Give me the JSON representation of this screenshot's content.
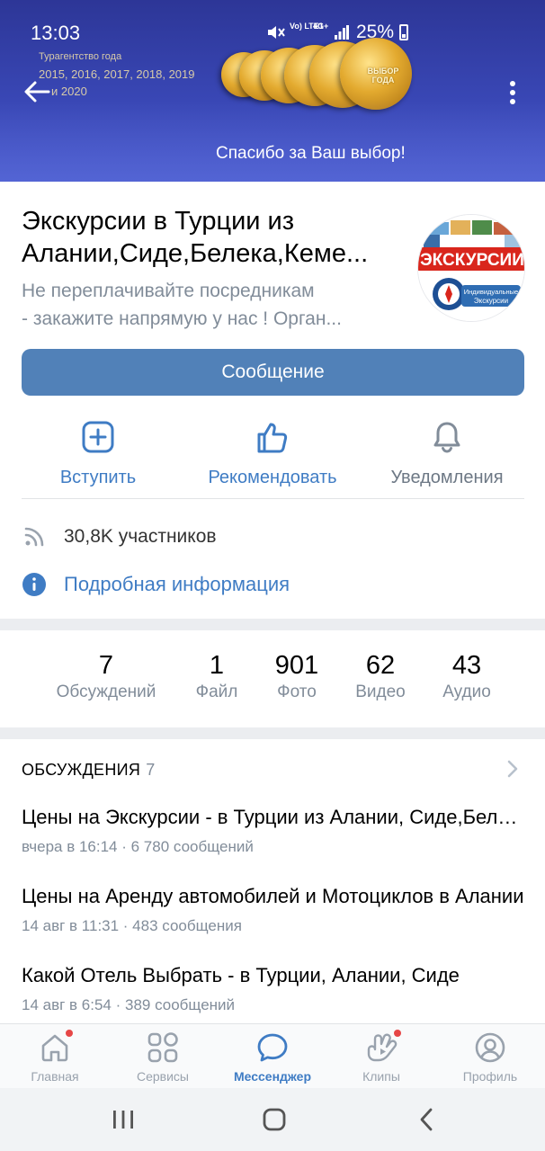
{
  "status_bar": {
    "time": "13:03",
    "network_1": "Vo) LTE1",
    "network_2": "4G+",
    "battery": "25%"
  },
  "cover": {
    "award_text_line1": "Турагентство года",
    "award_text_line2": "2015, 2016, 2017, 2018, 2019",
    "award_text_line3": "и 2020",
    "coin_label": "ВЫБОР ГОДА",
    "caption": "Спасибо за Ваш выбор!",
    "back_icon": "arrow-left-icon",
    "menu_icon": "more-vertical-icon"
  },
  "group": {
    "title_line1": "Экскурсии в Турции из",
    "title_line2": "Алании,Сиде,Белека,Кеме...",
    "status_line1": "Не переплачивайте посредникам",
    "status_line2": "- закажите напрямую у нас ! Орган...",
    "avatar_text": "ЭКСКУРСИИ",
    "avatar_subtext_1": "Индивидуальные",
    "avatar_subtext_2": "Экскурсии"
  },
  "actions": {
    "message_label": "Сообщение",
    "join_label": "Вступить",
    "recommend_label": "Рекомендовать",
    "notifications_label": "Уведомления"
  },
  "info": {
    "members": "30,8K участников",
    "details": "Подробная информация"
  },
  "counters": [
    {
      "value": "7",
      "label": "Обсуждений"
    },
    {
      "value": "1",
      "label": "Файл"
    },
    {
      "value": "901",
      "label": "Фото"
    },
    {
      "value": "62",
      "label": "Видео"
    },
    {
      "value": "43",
      "label": "Аудио"
    }
  ],
  "discussions": {
    "header": "ОБСУЖДЕНИЯ",
    "count": "7",
    "topics": [
      {
        "title": "Цены на Экскурсии - в Турции из Алании, Сиде,Белека",
        "meta": "вчера в 16:14 · 6 780 сообщений"
      },
      {
        "title": "Цены на Аренду автомобилей и Мотоциклов в Алании",
        "meta": "14 авг в 11:31 · 483 сообщения"
      },
      {
        "title": "Какой Отель Выбрать -  в Турции, Алании, Сиде",
        "meta": "14 авг в 6:54 · 389 сообщений"
      }
    ]
  },
  "tabbar": {
    "home": "Главная",
    "services": "Сервисы",
    "messenger": "Мессенджер",
    "clips": "Клипы",
    "profile": "Профиль",
    "accent_color": "#3f7cc4",
    "badge_color": "#e64646"
  }
}
